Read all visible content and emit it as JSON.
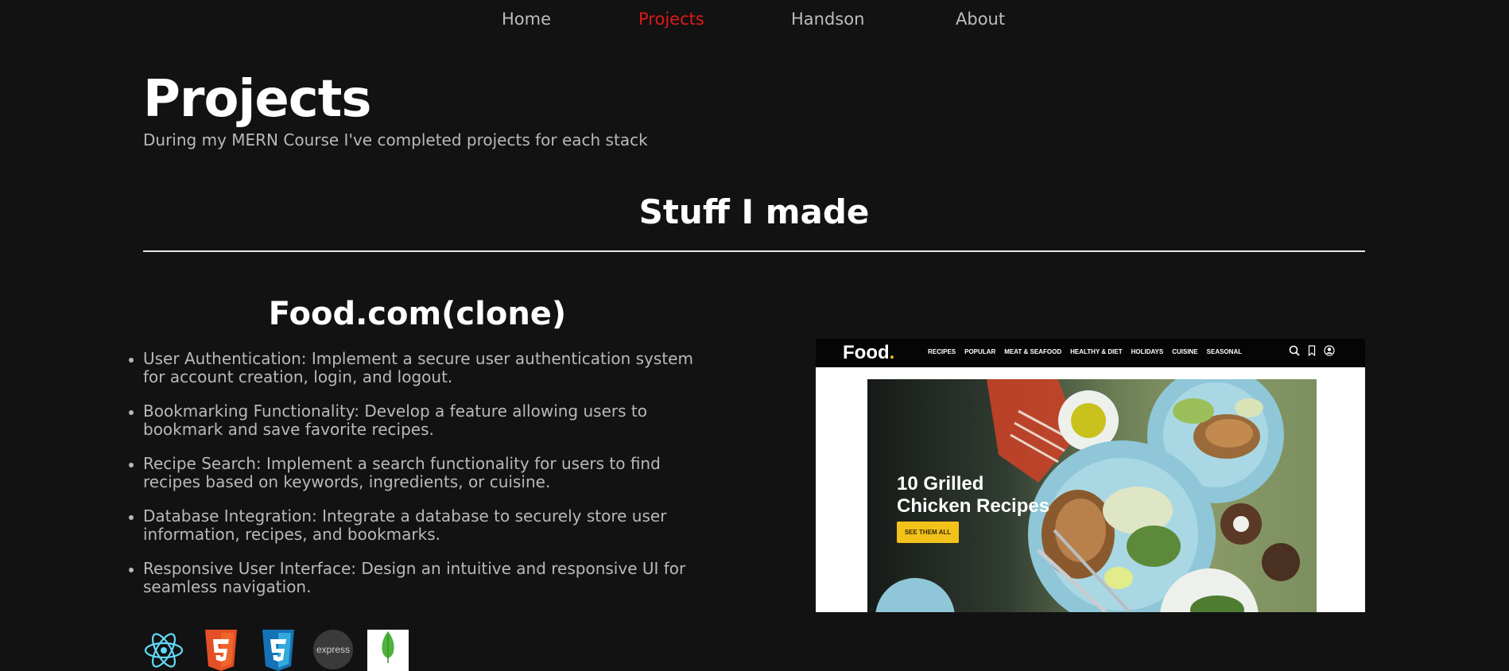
{
  "nav": {
    "items": [
      {
        "label": "Home"
      },
      {
        "label": "Projects",
        "active": true
      },
      {
        "label": "Handson"
      },
      {
        "label": "About"
      }
    ],
    "active_color": "#e01818"
  },
  "header": {
    "title": "Projects",
    "subtitle": "During my MERN Course I've completed projects for each stack"
  },
  "section": {
    "title": "Stuff I made"
  },
  "project": {
    "title": "Food.com(clone)",
    "features": [
      "User Authentication: Implement a secure user authentication system for account creation, login, and logout.",
      "Bookmarking Functionality: Develop a feature allowing users to bookmark and save favorite recipes.",
      "Recipe Search: Implement a search functionality for users to find recipes based on keywords, ingredients, or cuisine.",
      "Database Integration: Integrate a database to securely store user information, recipes, and bookmarks.",
      "Responsive User Interface: Design an intuitive and responsive UI for seamless navigation."
    ],
    "tech_icons": [
      "react-icon",
      "html5-icon",
      "css3-icon",
      "express-icon",
      "mongodb-icon"
    ],
    "tech_labels": {
      "express": "express"
    },
    "screenshot": {
      "logo": "Food",
      "logo_dot": ".",
      "menu": [
        "RECIPES",
        "POPULAR",
        "MEAT & SEAFOOD",
        "HEALTHY & DIET",
        "HOLIDAYS",
        "CUISINE",
        "SEASONAL"
      ],
      "hero_line1": "10 Grilled",
      "hero_line2": "Chicken Recipes",
      "hero_button": "SEE THEM ALL"
    }
  }
}
